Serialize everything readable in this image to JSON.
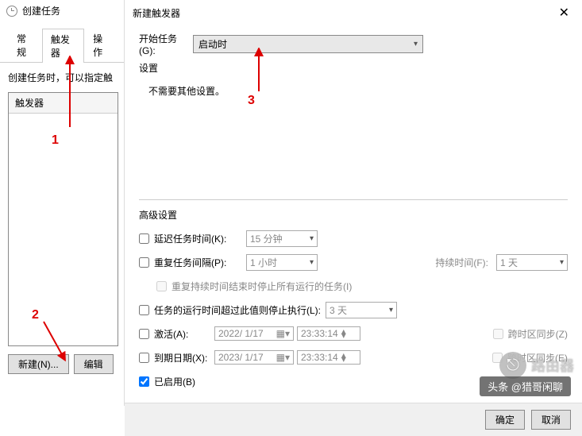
{
  "backWindow": {
    "title": "创建任务",
    "tabs": [
      "常规",
      "触发器",
      "操作"
    ],
    "activeTab": 1,
    "desc": "创建任务时，可以指定触",
    "listHeader": "触发器",
    "newBtn": "新建(N)...",
    "editBtn": "编辑"
  },
  "dialog": {
    "title": "新建触发器",
    "close": "✕",
    "startTaskLabel": "开始任务(G):",
    "startTaskValue": "启动时",
    "settingsLabel": "设置",
    "noOther": "不需要其他设置。",
    "advTitle": "高级设置",
    "delay": {
      "label": "延迟任务时间(K):",
      "value": "15 分钟"
    },
    "repeat": {
      "label": "重复任务间隔(P):",
      "value": "1 小时",
      "durationLabel": "持续时间(F):",
      "durationValue": "1 天"
    },
    "stopAtEnd": "重复持续时间结束时停止所有运行的任务(I)",
    "stopIfLong": {
      "label": "任务的运行时间超过此值则停止执行(L):",
      "value": "3 天"
    },
    "activate": {
      "label": "激活(A):",
      "date": "2022/ 1/17",
      "time": "23:33:14",
      "tz": "跨时区同步(Z)"
    },
    "expire": {
      "label": "到期日期(X):",
      "date": "2023/ 1/17",
      "time": "23:33:14",
      "tz": "跨时区同步(E)"
    },
    "enabled": "已启用(B)",
    "ok": "确定",
    "cancel": "取消"
  },
  "annotations": {
    "a1": "1",
    "a2": "2",
    "a3": "3"
  },
  "watermark": {
    "text": "头条 @猎哥闲聊",
    "icon": "路由器"
  }
}
